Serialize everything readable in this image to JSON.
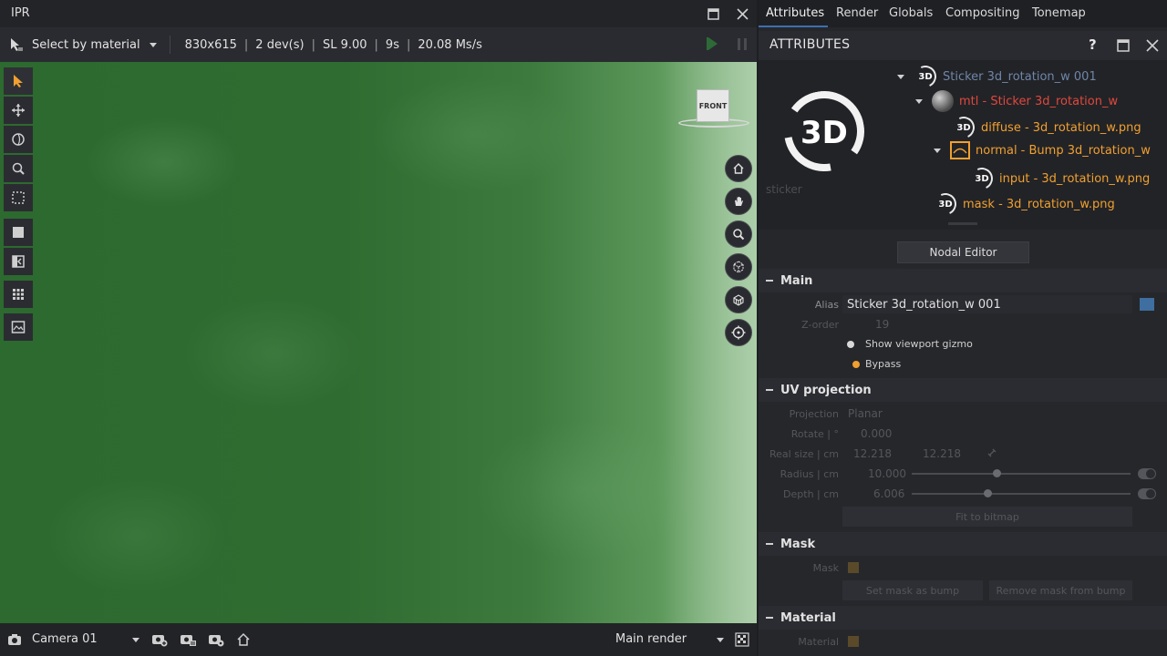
{
  "ipr": {
    "title": "IPR",
    "toolbar": {
      "selection_mode": "Select by material",
      "resolution": "830x615",
      "devices": "2 dev(s)",
      "sample_level": "SL 9.00",
      "time": "9s",
      "speed": "20.08 Ms/s",
      "sep": "|"
    },
    "viewport": {
      "cube_label": "FRONT",
      "background_color": "#2f6c31"
    },
    "left_tools": [
      "select-arrow-icon",
      "move-icon",
      "rotate-icon",
      "zoom-icon",
      "marquee-icon",
      "full-frame-icon",
      "split-view-icon",
      "grid-icon",
      "snapshot-icon"
    ],
    "nav_tools": [
      "home-icon",
      "pan-hand-icon",
      "zoom-magnifier-icon",
      "object-view-icon",
      "scene-view-icon",
      "focus-target-icon"
    ],
    "bottom": {
      "camera": "Camera 01",
      "render_target": "Main render"
    }
  },
  "attributes": {
    "tabs": [
      "Attributes",
      "Render",
      "Globals",
      "Compositing",
      "Tonemap"
    ],
    "active_tab": "Attributes",
    "header_title": "ATTRIBUTES",
    "help_glyph": "?",
    "preview_caption": "sticker",
    "big_badge": "3D",
    "badge": "3D",
    "tree": [
      {
        "label": "Sticker 3d_rotation_w 001",
        "color": "#6f86a8"
      },
      {
        "label": "mtl - Sticker 3d_rotation_w",
        "color": "#e0483c"
      },
      {
        "label": "diffuse - 3d_rotation_w.png",
        "color": "#f0a030"
      },
      {
        "label": "normal - Bump 3d_rotation_w",
        "color": "#f0a030"
      },
      {
        "label": "input - 3d_rotation_w.png",
        "color": "#f0a030"
      },
      {
        "label": "mask - 3d_rotation_w.png",
        "color": "#f0a030"
      }
    ],
    "nodal_editor": "Nodal Editor",
    "main": {
      "title": "Main",
      "alias_label": "Alias",
      "alias_value": "Sticker 3d_rotation_w 001",
      "alias_color": "#3f6ea0",
      "zorder_label": "Z-order",
      "zorder_value": "19",
      "gizmo_label": "Show viewport gizmo",
      "bypass_label": "Bypass"
    },
    "uv": {
      "title": "UV projection",
      "projection_label": "Projection",
      "projection_value": "Planar",
      "rotate_label": "Rotate | °",
      "rotate_value": "0.000",
      "realsize_label": "Real size | cm",
      "realsize_x": "12.218",
      "realsize_y": "12.218",
      "radius_label": "Radius | cm",
      "radius_value": "10.000",
      "depth_label": "Depth | cm",
      "depth_value": "6.006",
      "fit_button": "Fit to bitmap"
    },
    "mask": {
      "title": "Mask",
      "mask_label": "Mask",
      "set_button": "Set mask as bump",
      "remove_button": "Remove mask from bump"
    },
    "material": {
      "title": "Material",
      "material_label": "Material"
    }
  }
}
